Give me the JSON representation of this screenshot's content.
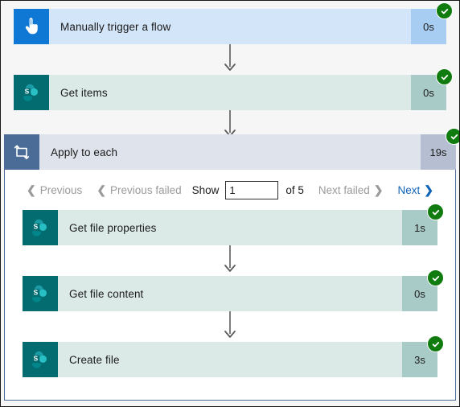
{
  "flow": {
    "steps": [
      {
        "name": "Manually trigger a flow",
        "duration": "0s",
        "icon": "touch-trigger-icon",
        "status": "succeeded",
        "style": "trigger"
      },
      {
        "name": "Get items",
        "duration": "0s",
        "icon": "sharepoint-icon",
        "status": "succeeded",
        "style": "sharepoint"
      }
    ],
    "scope": {
      "name": "Apply to each",
      "duration": "19s",
      "icon": "apply-to-each-icon",
      "status": "succeeded",
      "pager": {
        "previous_label": "Previous",
        "previous_failed_label": "Previous failed",
        "show_label": "Show",
        "current_page": "1",
        "page_placeholder": "",
        "total_label": "of 5",
        "next_failed_label": "Next failed",
        "next_label": "Next",
        "previous_enabled": false,
        "previous_failed_enabled": false,
        "next_failed_enabled": false,
        "next_enabled": true
      },
      "steps": [
        {
          "name": "Get file properties",
          "duration": "1s",
          "icon": "sharepoint-icon",
          "status": "succeeded",
          "style": "sharepoint"
        },
        {
          "name": "Get file content",
          "duration": "0s",
          "icon": "sharepoint-icon",
          "status": "succeeded",
          "style": "sharepoint"
        },
        {
          "name": "Create file",
          "duration": "3s",
          "icon": "sharepoint-icon",
          "status": "succeeded",
          "style": "sharepoint"
        }
      ]
    }
  },
  "colors": {
    "success_green": "#107c10",
    "trigger_blue": "#0f78d4",
    "sharepoint_teal": "#036c70",
    "scope_slate": "#4a6c96",
    "link_blue": "#1063b7",
    "disabled_gray": "#9a9a9a"
  }
}
